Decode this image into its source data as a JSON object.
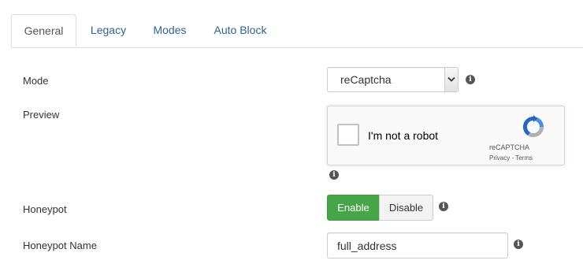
{
  "tabs": [
    {
      "label": "General",
      "active": true
    },
    {
      "label": "Legacy",
      "active": false
    },
    {
      "label": "Modes",
      "active": false
    },
    {
      "label": "Auto Block",
      "active": false
    }
  ],
  "fields": {
    "mode": {
      "label": "Mode",
      "value": "reCaptcha"
    },
    "preview": {
      "label": "Preview",
      "captcha_text": "I'm not a robot",
      "captcha_brand": "reCAPTCHA",
      "captcha_privacy": "Privacy",
      "captcha_sep": " - ",
      "captcha_terms": "Terms"
    },
    "honeypot": {
      "label": "Honeypot",
      "enable_label": "Enable",
      "disable_label": "Disable",
      "selected": "Enable"
    },
    "honeypot_name": {
      "label": "Honeypot Name",
      "value": "full_address"
    }
  },
  "colors": {
    "enable_active": "#46a546",
    "tab_link": "#2a6496",
    "recaptcha_blue": "#4a90e2",
    "recaptcha_gray": "#b0b0b0"
  },
  "icons": {
    "info": "info-circle-icon",
    "select": "chevron-down-icon",
    "recaptcha": "recaptcha-logo-icon"
  }
}
